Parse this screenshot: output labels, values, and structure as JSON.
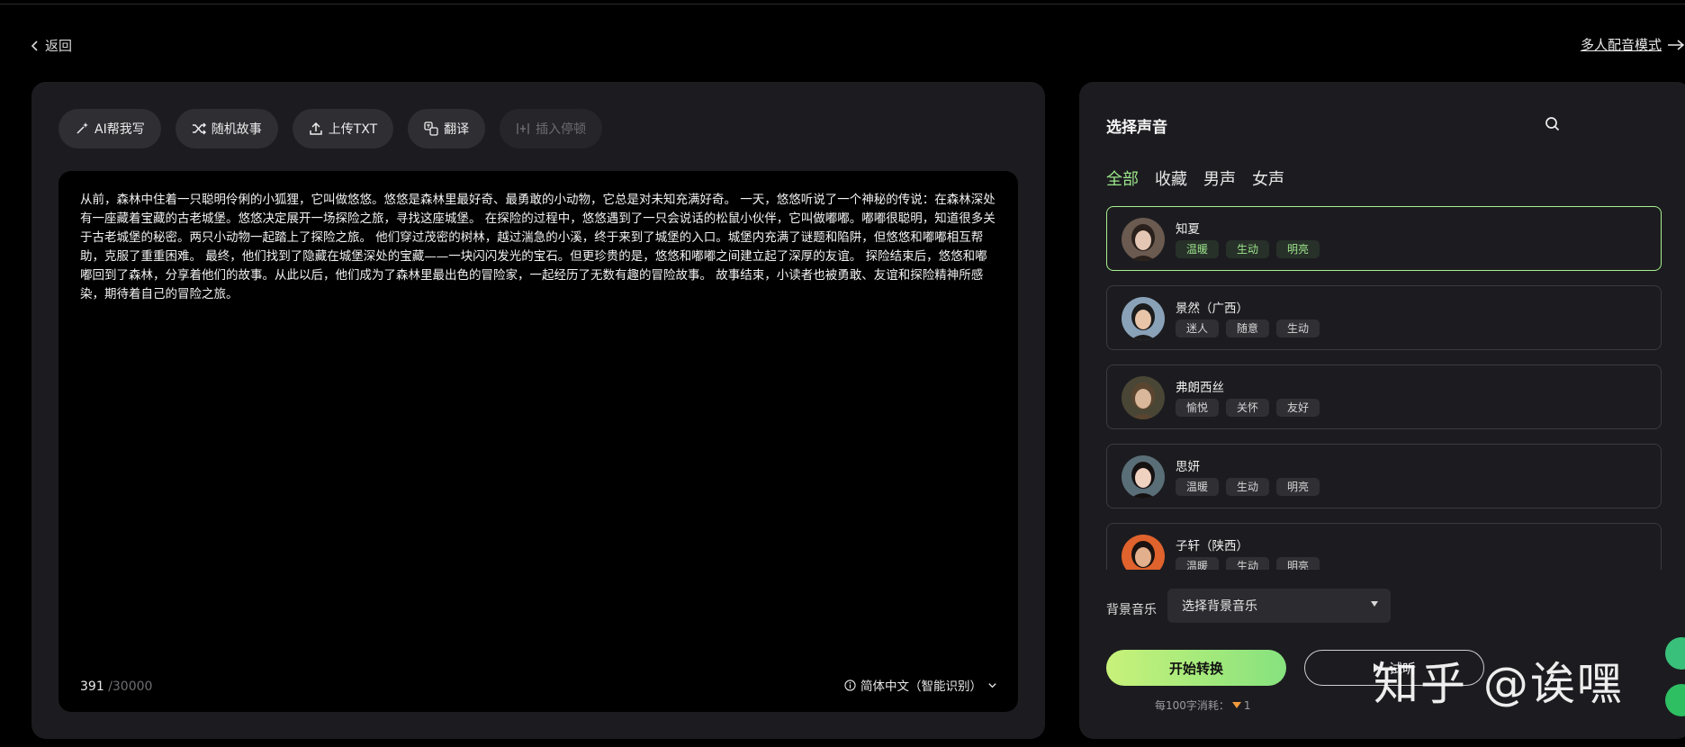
{
  "nav": {
    "back_label": "返回",
    "multi_mode_label": "多人配音模式"
  },
  "toolbar": [
    {
      "label": "AI帮我写",
      "icon": "sparkle-pen-icon",
      "enabled": true
    },
    {
      "label": "随机故事",
      "icon": "shuffle-icon",
      "enabled": true
    },
    {
      "label": "上传TXT",
      "icon": "upload-icon",
      "enabled": true
    },
    {
      "label": "翻译",
      "icon": "translate-icon",
      "enabled": true
    },
    {
      "label": "插入停顿",
      "icon": "pause-insert-icon",
      "enabled": false
    }
  ],
  "editor": {
    "text": "从前，森林中住着一只聪明伶俐的小狐狸，它叫做悠悠。悠悠是森林里最好奇、最勇敢的小动物，它总是对未知充满好奇。 一天，悠悠听说了一个神秘的传说：在森林深处有一座藏着宝藏的古老城堡。悠悠决定展开一场探险之旅，寻找这座城堡。 在探险的过程中，悠悠遇到了一只会说话的松鼠小伙伴，它叫做嘟嘟。嘟嘟很聪明，知道很多关于古老城堡的秘密。两只小动物一起踏上了探险之旅。 他们穿过茂密的树林，越过湍急的小溪，终于来到了城堡的入口。城堡内充满了谜题和陷阱，但悠悠和嘟嘟相互帮助，克服了重重困难。 最终，他们找到了隐藏在城堡深处的宝藏——一块闪闪发光的宝石。但更珍贵的是，悠悠和嘟嘟之间建立起了深厚的友谊。 探险结束后，悠悠和嘟嘟回到了森林，分享着他们的故事。从此以后，他们成为了森林里最出色的冒险家，一起经历了无数有趣的冒险故事。 故事结束，小读者也被勇敢、友谊和探险精神所感染，期待着自己的冒险之旅。",
    "char_count": "391",
    "char_max": "/30000",
    "language_label": "简体中文（智能识别）"
  },
  "voice_panel": {
    "title": "选择声音",
    "tabs": [
      "全部",
      "收藏",
      "男声",
      "女声"
    ],
    "active_tab": 0,
    "voices": [
      {
        "name": "知夏",
        "tags": [
          "温暖",
          "生动",
          "明亮"
        ],
        "selected": true,
        "avatar_bg": "#6b5a50",
        "avatar_skin": "#e4c6b4",
        "avatar_hair": "#2a201c"
      },
      {
        "name": "景然（广西）",
        "tags": [
          "迷人",
          "随意",
          "生动"
        ],
        "selected": false,
        "avatar_bg": "#8aa2b8",
        "avatar_skin": "#e8c4a8",
        "avatar_hair": "#1c1c1c"
      },
      {
        "name": "弗朗西丝",
        "tags": [
          "愉悦",
          "关怀",
          "友好"
        ],
        "selected": false,
        "avatar_bg": "#4a4636",
        "avatar_skin": "#d9b79a",
        "avatar_hair": "#5a4530"
      },
      {
        "name": "思妍",
        "tags": [
          "温暖",
          "生动",
          "明亮"
        ],
        "selected": false,
        "avatar_bg": "#5a6e78",
        "avatar_skin": "#f0d2c0",
        "avatar_hair": "#161212"
      },
      {
        "name": "子轩（陕西）",
        "tags": [
          "温暖",
          "生动",
          "明亮"
        ],
        "selected": false,
        "avatar_bg": "#e0622c",
        "avatar_skin": "#e2b08c",
        "avatar_hair": "#1a1210"
      }
    ],
    "bgm_label": "背景音乐",
    "bgm_placeholder": "选择背景音乐",
    "start_label": "开始转换",
    "preview_label": "试听",
    "cost_text": "每100字消耗：",
    "cost_value": "1"
  },
  "watermark": "知乎 @诶嘿",
  "colors": {
    "accent": "#9be58a",
    "panel": "#1c1c20",
    "start_gradient_from": "#c8f27a",
    "start_gradient_to": "#86e27e"
  }
}
